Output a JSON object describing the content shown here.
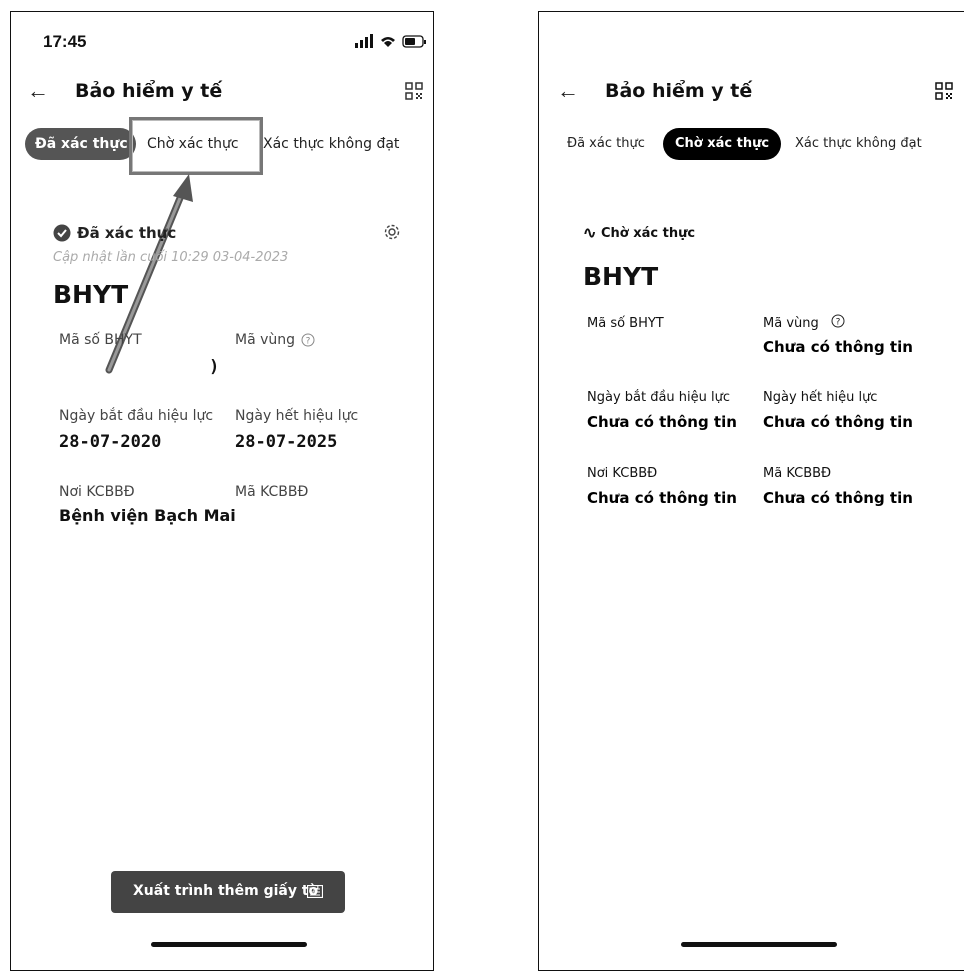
{
  "left": {
    "status_bar": {
      "time": "17:45"
    },
    "header": {
      "back_icon": "arrow-left-icon",
      "title": "Bảo hiểm y tế",
      "qr_icon": "qr-code-icon"
    },
    "tabs": [
      {
        "label": "Đã xác thực",
        "active": true
      },
      {
        "label": "Chờ xác thực",
        "active": false
      },
      {
        "label": "Xác thực không đạt",
        "active": false
      }
    ],
    "card": {
      "status_label": "Đã xác thực",
      "updated_text": "Cập nhật lần cuối 10:29 03-04-2023",
      "title": "BHYT",
      "fields": {
        "ma_so_label": "Mã số BHYT",
        "ma_so_value": "",
        "ma_vung_label": "Mã vùng",
        "ma_vung_value": ")",
        "ngay_bat_dau_label": "Ngày bắt đầu hiệu lực",
        "ngay_bat_dau_value": "28-07-2020",
        "ngay_het_label": "Ngày hết hiệu lực",
        "ngay_het_value": "28-07-2025",
        "noi_kcb_label": "Nơi KCBBĐ",
        "noi_kcb_value": "Bệnh viện Bạch Mai",
        "ma_kcb_label": "Mã KCBBĐ",
        "ma_kcb_value": ""
      }
    },
    "export_button": "Xuất trình thêm giấy tờ"
  },
  "right": {
    "header": {
      "title": "Bảo hiểm y tế"
    },
    "tabs": [
      {
        "label": "Đã xác thực",
        "active": false
      },
      {
        "label": "Chờ xác thực",
        "active": true
      },
      {
        "label": "Xác thực không đạt",
        "active": false
      }
    ],
    "card": {
      "status_label": "Chờ xác thực",
      "title": "BHYT",
      "fields": {
        "ma_so_label": "Mã số BHYT",
        "ma_vung_label": "Mã vùng",
        "ma_vung_value": "Chưa có thông tin",
        "ngay_bat_dau_label": "Ngày bắt đầu hiệu lực",
        "ngay_bat_dau_value": "Chưa có thông tin",
        "ngay_het_label": "Ngày hết hiệu lực",
        "ngay_het_value": "Chưa có thông tin",
        "noi_kcb_label": "Nơi KCBBĐ",
        "noi_kcb_value": "Chưa có thông tin",
        "ma_kcb_label": "Mã KCBBĐ",
        "ma_kcb_value": "Chưa có thông tin"
      }
    }
  }
}
